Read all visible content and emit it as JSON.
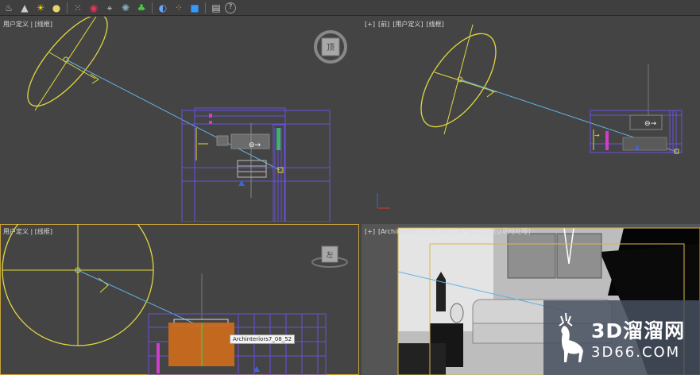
{
  "toolbar": {
    "icons": [
      "teapot-icon",
      "cone-icon",
      "sun-icon",
      "sphere-icon",
      "particles-icon",
      "dynamics-icon",
      "helper-icon",
      "spacewarp-icon",
      "plant-icon",
      "render-sphere-icon",
      "color-dots-icon",
      "camera-icon",
      "panel-icon",
      "help-icon"
    ],
    "help_label": "?"
  },
  "viewports": {
    "top_left": {
      "label": "用户定义 | [线框]"
    },
    "top_right": {
      "label_plus": "[+]",
      "label_view": "[前]",
      "label_custom": "[用户定义]",
      "label_mode": "[线框]"
    },
    "bottom_left": {
      "label": "用户定义 | [线框]"
    },
    "bottom_right": {
      "label_plus": "[+]",
      "label_view": "[Archinteriors7_08_08]",
      "label_custom": "[用户定义]",
      "label_mode": "[默认明暗处理]"
    }
  },
  "viewcube": {
    "top_label": "顶",
    "left_label": "左"
  },
  "selection_tag": "Archinteriors7_08_52",
  "watermark": {
    "line1": "3D溜溜网",
    "line2": "3D66.COM"
  },
  "colors": {
    "light_yellow": "#e0d840",
    "light_blue": "#5fb2e6",
    "wire_purple": "#6a4fe0",
    "active_border": "#c8a23a"
  }
}
